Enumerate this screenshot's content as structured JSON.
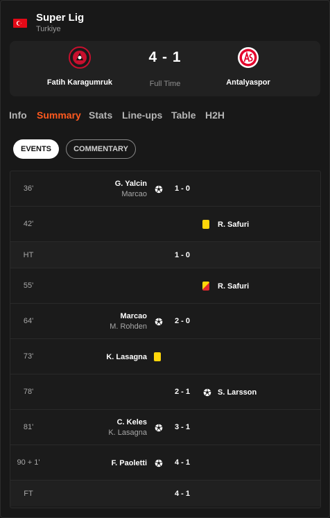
{
  "league": {
    "name": "Super Lig",
    "country": "Turkiye",
    "flag_color": "#e30a17"
  },
  "match": {
    "home_team": "Fatih Karagumruk",
    "away_team": "Antalyaspor",
    "score": "4 - 1",
    "status": "Full Time",
    "home_crest_color": "#c8102e",
    "away_crest_color": "#e4002b"
  },
  "tabs": [
    "Info",
    "Summary",
    "Stats",
    "Line-ups",
    "Table",
    "H2H"
  ],
  "active_tab": "Summary",
  "filters": {
    "events": "EVENTS",
    "commentary": "COMMENTARY"
  },
  "events": [
    {
      "minute": "36'",
      "type": "goal",
      "side": "home",
      "player": "G. Yalcin",
      "assist": "Marcao",
      "score": "1 - 0"
    },
    {
      "minute": "42'",
      "type": "yellow",
      "side": "away",
      "player": "R. Safuri"
    },
    {
      "minute": "HT",
      "type": "period",
      "score": "1 - 0"
    },
    {
      "minute": "55'",
      "type": "second_yellow",
      "side": "away",
      "player": "R. Safuri"
    },
    {
      "minute": "64'",
      "type": "goal",
      "side": "home",
      "player": "Marcao",
      "assist": "M. Rohden",
      "score": "2 - 0"
    },
    {
      "minute": "73'",
      "type": "yellow",
      "side": "home",
      "player": "K. Lasagna"
    },
    {
      "minute": "78'",
      "type": "goal",
      "side": "away",
      "player": "S. Larsson",
      "score": "2 - 1"
    },
    {
      "minute": "81'",
      "type": "goal",
      "side": "home",
      "player": "C. Keles",
      "assist": "K. Lasagna",
      "score": "3 - 1"
    },
    {
      "minute": "90 + 1'",
      "type": "goal",
      "side": "home",
      "player": "F. Paoletti",
      "score": "4 - 1"
    },
    {
      "minute": "FT",
      "type": "period",
      "score": "4 - 1"
    }
  ]
}
